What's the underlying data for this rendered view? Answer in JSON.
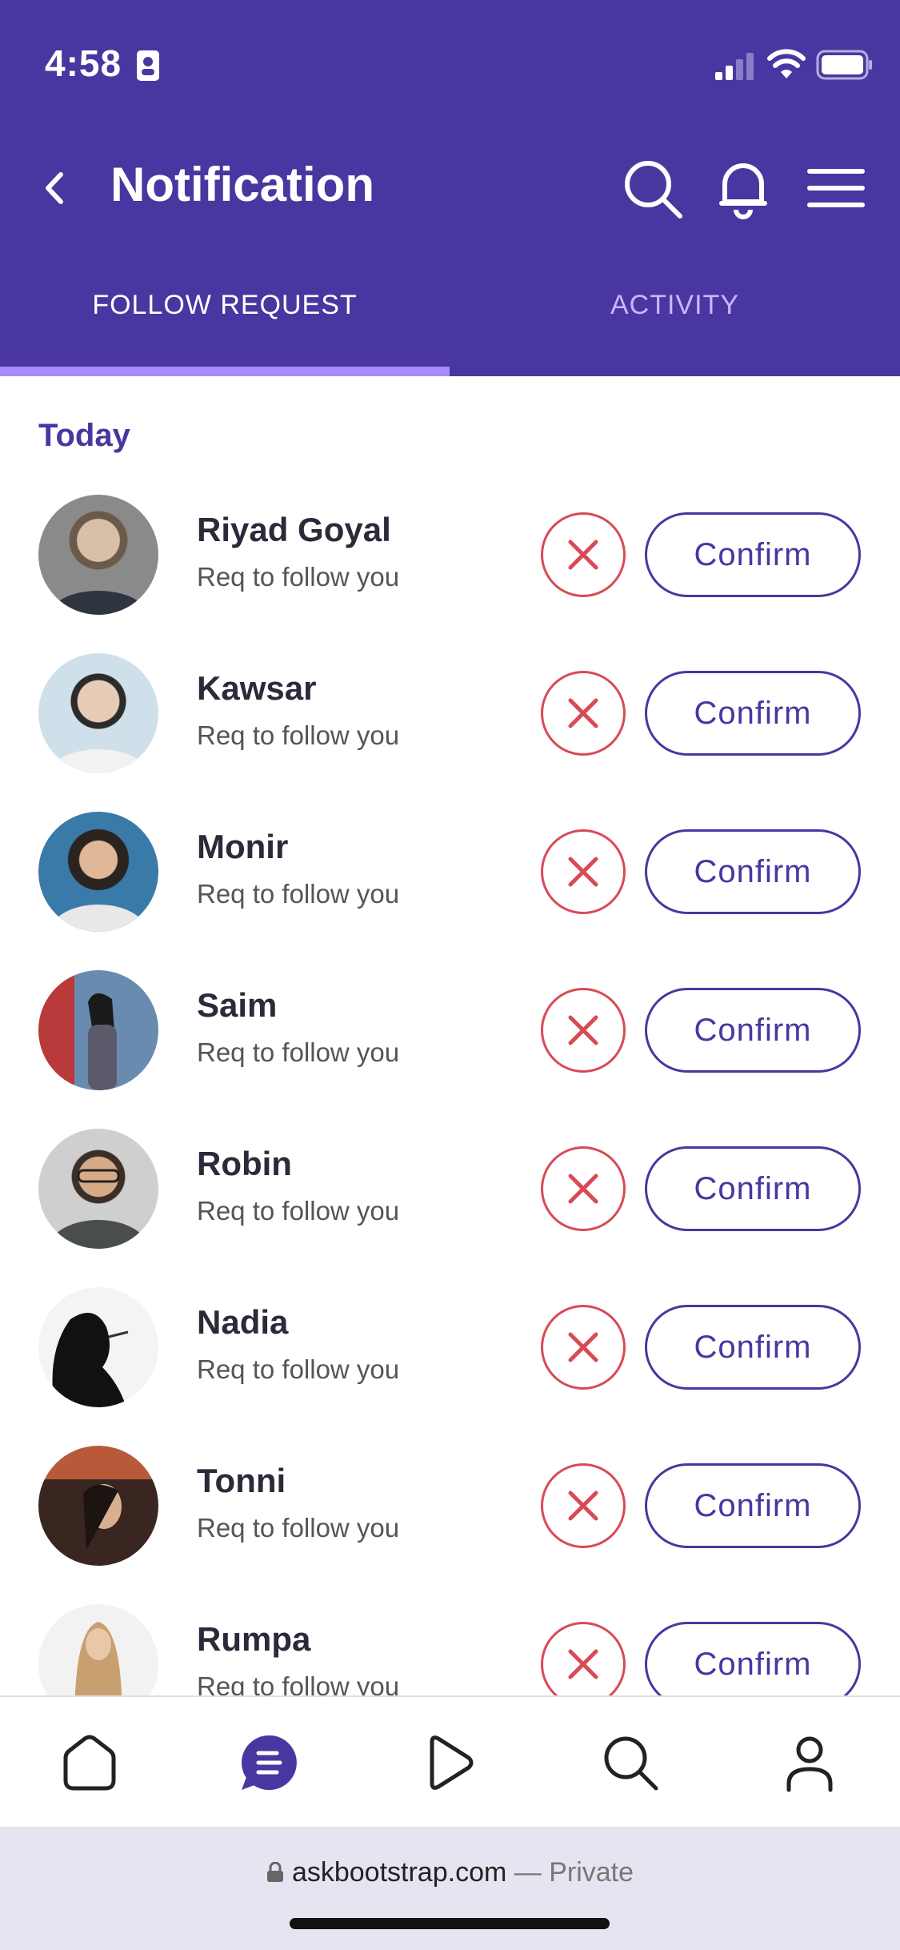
{
  "status_bar": {
    "time": "4:58"
  },
  "header": {
    "title": "Notification"
  },
  "tabs": [
    {
      "label": "FOLLOW REQUEST",
      "active": true
    },
    {
      "label": "ACTIVITY",
      "active": false
    }
  ],
  "section": {
    "title": "Today"
  },
  "requests": [
    {
      "name": "Riyad Goyal",
      "subtitle": "Req to follow you",
      "confirm_label": "Confirm"
    },
    {
      "name": "Kawsar",
      "subtitle": "Req to follow you",
      "confirm_label": "Confirm"
    },
    {
      "name": "Monir",
      "subtitle": "Req to follow you",
      "confirm_label": "Confirm"
    },
    {
      "name": "Saim",
      "subtitle": "Req to follow you",
      "confirm_label": "Confirm"
    },
    {
      "name": "Robin",
      "subtitle": "Req to follow you",
      "confirm_label": "Confirm"
    },
    {
      "name": "Nadia",
      "subtitle": "Req to follow you",
      "confirm_label": "Confirm"
    },
    {
      "name": "Tonni",
      "subtitle": "Req to follow you",
      "confirm_label": "Confirm"
    },
    {
      "name": "Rumpa",
      "subtitle": "Req to follow you",
      "confirm_label": "Confirm"
    }
  ],
  "bottom_nav": {
    "items": [
      "home-icon",
      "notification-icon",
      "play-icon",
      "search-icon",
      "profile-icon"
    ],
    "active": "notification-icon"
  },
  "browser": {
    "url": "askbootstrap.com",
    "mode": "— Private"
  },
  "colors": {
    "primary": "#4a36a0",
    "accent": "#a78bfa",
    "decline": "#d84a55"
  }
}
